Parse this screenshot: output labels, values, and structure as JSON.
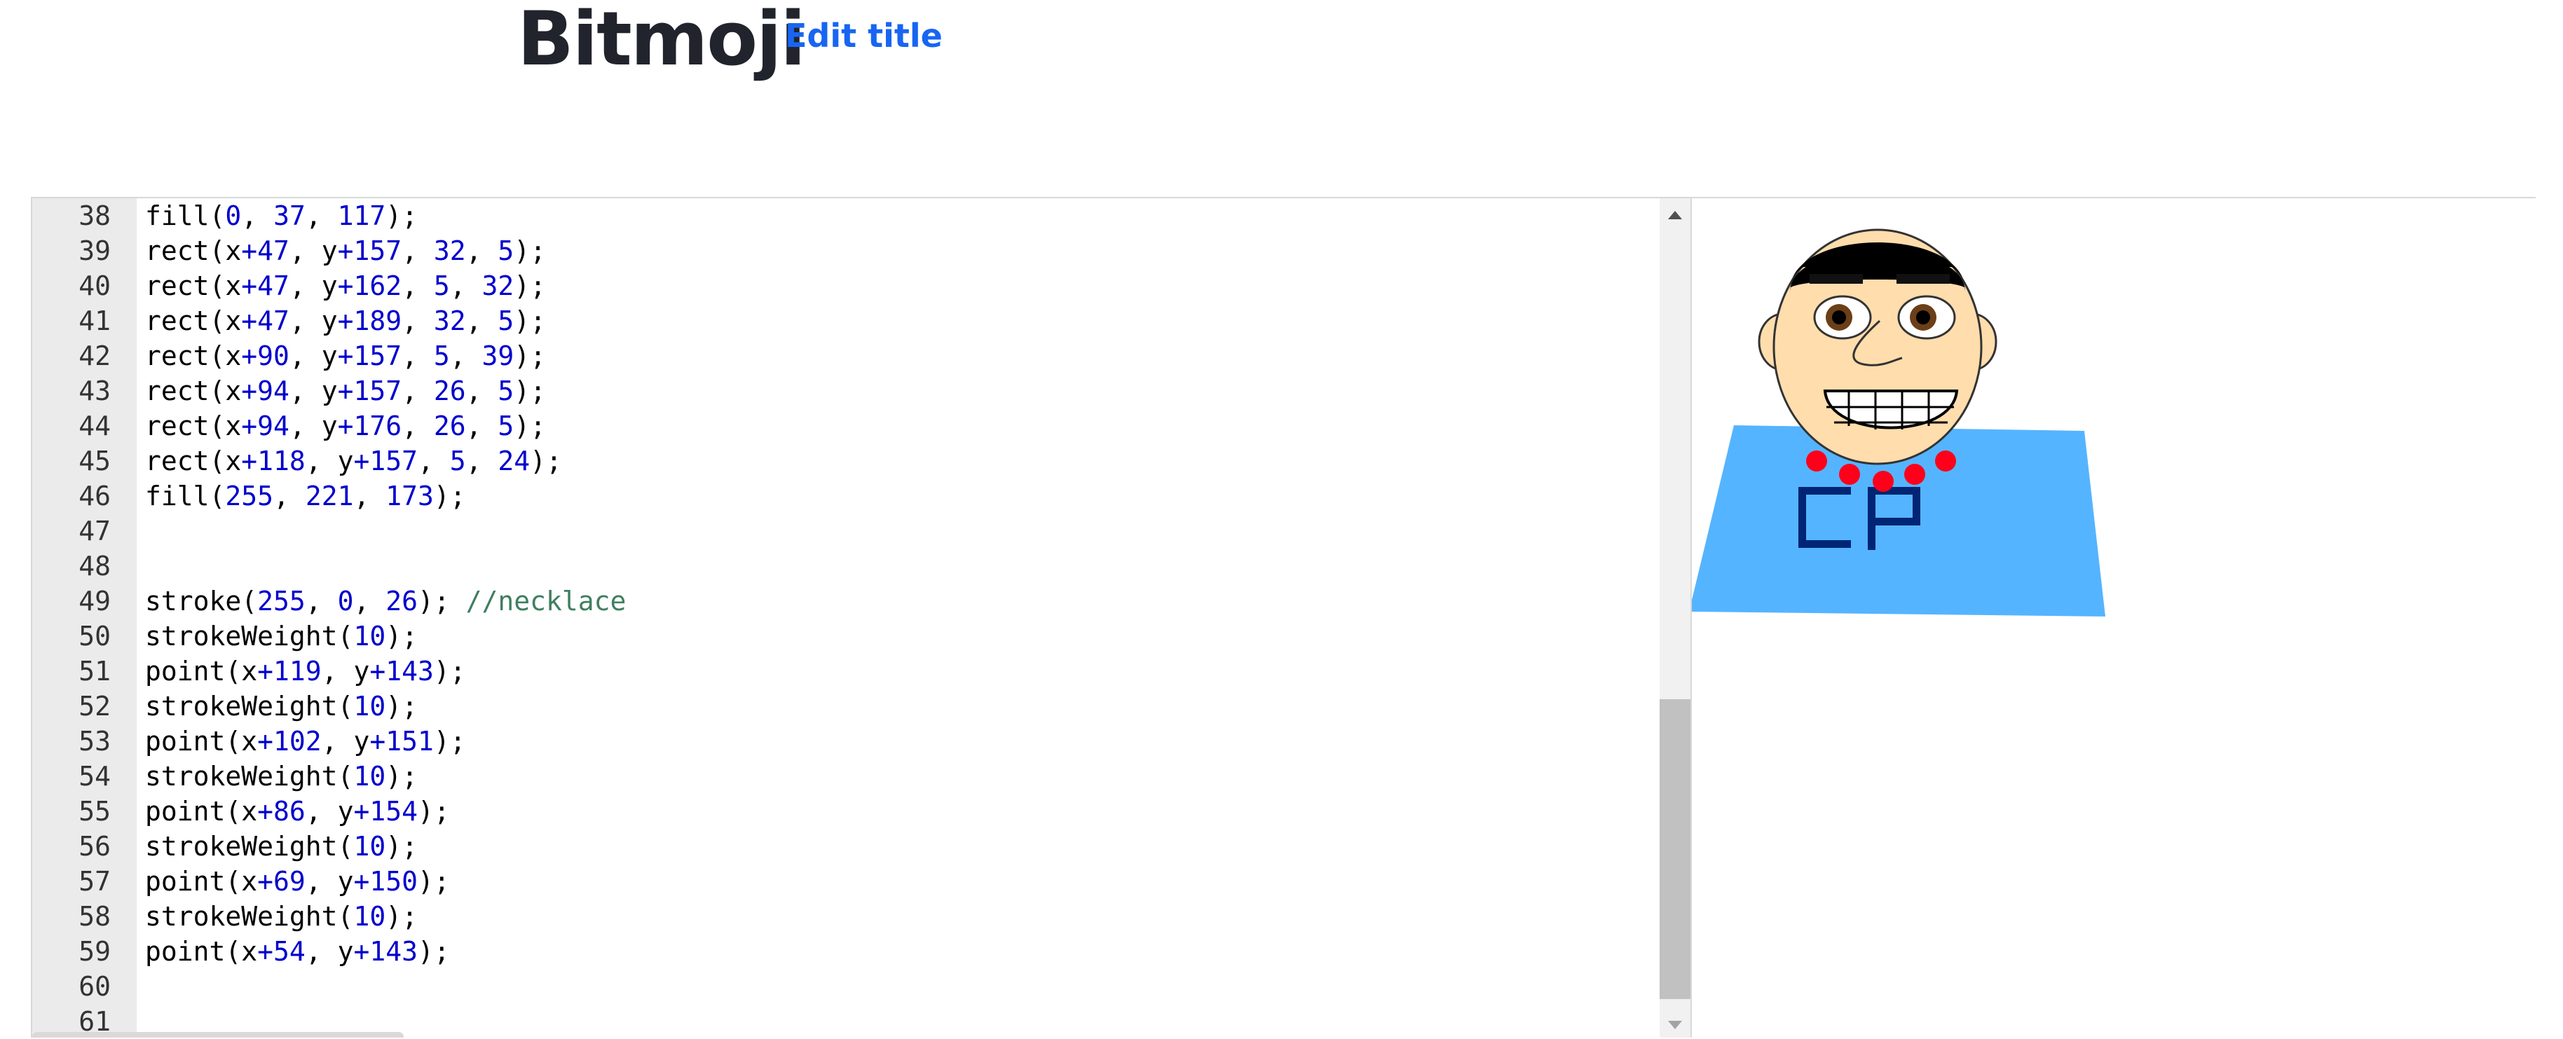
{
  "header": {
    "title": "Bitmoji",
    "edit_title_label": "Edit title"
  },
  "editor": {
    "lines": [
      {
        "n": "38",
        "tokens": [
          [
            "fn",
            "fill"
          ],
          [
            "p",
            "("
          ],
          [
            "num",
            "0"
          ],
          [
            "p",
            ", "
          ],
          [
            "num",
            "37"
          ],
          [
            "p",
            ", "
          ],
          [
            "num",
            "117"
          ],
          [
            "p",
            ");"
          ]
        ]
      },
      {
        "n": "39",
        "tokens": [
          [
            "fn",
            "rect"
          ],
          [
            "p",
            "(x"
          ],
          [
            "op",
            "+"
          ],
          [
            "num",
            "47"
          ],
          [
            "p",
            ", y"
          ],
          [
            "op",
            "+"
          ],
          [
            "num",
            "157"
          ],
          [
            "p",
            ", "
          ],
          [
            "num",
            "32"
          ],
          [
            "p",
            ", "
          ],
          [
            "num",
            "5"
          ],
          [
            "p",
            ");"
          ]
        ]
      },
      {
        "n": "40",
        "tokens": [
          [
            "fn",
            "rect"
          ],
          [
            "p",
            "(x"
          ],
          [
            "op",
            "+"
          ],
          [
            "num",
            "47"
          ],
          [
            "p",
            ", y"
          ],
          [
            "op",
            "+"
          ],
          [
            "num",
            "162"
          ],
          [
            "p",
            ", "
          ],
          [
            "num",
            "5"
          ],
          [
            "p",
            ", "
          ],
          [
            "num",
            "32"
          ],
          [
            "p",
            ");"
          ]
        ]
      },
      {
        "n": "41",
        "tokens": [
          [
            "fn",
            "rect"
          ],
          [
            "p",
            "(x"
          ],
          [
            "op",
            "+"
          ],
          [
            "num",
            "47"
          ],
          [
            "p",
            ", y"
          ],
          [
            "op",
            "+"
          ],
          [
            "num",
            "189"
          ],
          [
            "p",
            ", "
          ],
          [
            "num",
            "32"
          ],
          [
            "p",
            ", "
          ],
          [
            "num",
            "5"
          ],
          [
            "p",
            ");"
          ]
        ]
      },
      {
        "n": "42",
        "tokens": [
          [
            "fn",
            "rect"
          ],
          [
            "p",
            "(x"
          ],
          [
            "op",
            "+"
          ],
          [
            "num",
            "90"
          ],
          [
            "p",
            ", y"
          ],
          [
            "op",
            "+"
          ],
          [
            "num",
            "157"
          ],
          [
            "p",
            ", "
          ],
          [
            "num",
            "5"
          ],
          [
            "p",
            ", "
          ],
          [
            "num",
            "39"
          ],
          [
            "p",
            ");"
          ]
        ]
      },
      {
        "n": "43",
        "tokens": [
          [
            "fn",
            "rect"
          ],
          [
            "p",
            "(x"
          ],
          [
            "op",
            "+"
          ],
          [
            "num",
            "94"
          ],
          [
            "p",
            ", y"
          ],
          [
            "op",
            "+"
          ],
          [
            "num",
            "157"
          ],
          [
            "p",
            ", "
          ],
          [
            "num",
            "26"
          ],
          [
            "p",
            ", "
          ],
          [
            "num",
            "5"
          ],
          [
            "p",
            ");"
          ]
        ]
      },
      {
        "n": "44",
        "tokens": [
          [
            "fn",
            "rect"
          ],
          [
            "p",
            "(x"
          ],
          [
            "op",
            "+"
          ],
          [
            "num",
            "94"
          ],
          [
            "p",
            ", y"
          ],
          [
            "op",
            "+"
          ],
          [
            "num",
            "176"
          ],
          [
            "p",
            ", "
          ],
          [
            "num",
            "26"
          ],
          [
            "p",
            ", "
          ],
          [
            "num",
            "5"
          ],
          [
            "p",
            ");"
          ]
        ]
      },
      {
        "n": "45",
        "tokens": [
          [
            "fn",
            "rect"
          ],
          [
            "p",
            "(x"
          ],
          [
            "op",
            "+"
          ],
          [
            "num",
            "118"
          ],
          [
            "p",
            ", y"
          ],
          [
            "op",
            "+"
          ],
          [
            "num",
            "157"
          ],
          [
            "p",
            ", "
          ],
          [
            "num",
            "5"
          ],
          [
            "p",
            ", "
          ],
          [
            "num",
            "24"
          ],
          [
            "p",
            ");"
          ]
        ]
      },
      {
        "n": "46",
        "tokens": [
          [
            "fn",
            "fill"
          ],
          [
            "p",
            "("
          ],
          [
            "num",
            "255"
          ],
          [
            "p",
            ", "
          ],
          [
            "num",
            "221"
          ],
          [
            "p",
            ", "
          ],
          [
            "num",
            "173"
          ],
          [
            "p",
            ");"
          ]
        ]
      },
      {
        "n": "47",
        "tokens": []
      },
      {
        "n": "48",
        "tokens": []
      },
      {
        "n": "49",
        "tokens": [
          [
            "fn",
            "stroke"
          ],
          [
            "p",
            "("
          ],
          [
            "num",
            "255"
          ],
          [
            "p",
            ", "
          ],
          [
            "num",
            "0"
          ],
          [
            "p",
            ", "
          ],
          [
            "num",
            "26"
          ],
          [
            "p",
            "); "
          ],
          [
            "com",
            "//necklace"
          ]
        ]
      },
      {
        "n": "50",
        "tokens": [
          [
            "fn",
            "strokeWeight"
          ],
          [
            "p",
            "("
          ],
          [
            "num",
            "10"
          ],
          [
            "p",
            ");"
          ]
        ]
      },
      {
        "n": "51",
        "tokens": [
          [
            "fn",
            "point"
          ],
          [
            "p",
            "(x"
          ],
          [
            "op",
            "+"
          ],
          [
            "num",
            "119"
          ],
          [
            "p",
            ", y"
          ],
          [
            "op",
            "+"
          ],
          [
            "num",
            "143"
          ],
          [
            "p",
            ");"
          ]
        ]
      },
      {
        "n": "52",
        "tokens": [
          [
            "fn",
            "strokeWeight"
          ],
          [
            "p",
            "("
          ],
          [
            "num",
            "10"
          ],
          [
            "p",
            ");"
          ]
        ]
      },
      {
        "n": "53",
        "tokens": [
          [
            "fn",
            "point"
          ],
          [
            "p",
            "(x"
          ],
          [
            "op",
            "+"
          ],
          [
            "num",
            "102"
          ],
          [
            "p",
            ", y"
          ],
          [
            "op",
            "+"
          ],
          [
            "num",
            "151"
          ],
          [
            "p",
            ");"
          ]
        ]
      },
      {
        "n": "54",
        "tokens": [
          [
            "fn",
            "strokeWeight"
          ],
          [
            "p",
            "("
          ],
          [
            "num",
            "10"
          ],
          [
            "p",
            ");"
          ]
        ]
      },
      {
        "n": "55",
        "tokens": [
          [
            "fn",
            "point"
          ],
          [
            "p",
            "(x"
          ],
          [
            "op",
            "+"
          ],
          [
            "num",
            "86"
          ],
          [
            "p",
            ", y"
          ],
          [
            "op",
            "+"
          ],
          [
            "num",
            "154"
          ],
          [
            "p",
            ");"
          ]
        ]
      },
      {
        "n": "56",
        "tokens": [
          [
            "fn",
            "strokeWeight"
          ],
          [
            "p",
            "("
          ],
          [
            "num",
            "10"
          ],
          [
            "p",
            ");"
          ]
        ]
      },
      {
        "n": "57",
        "tokens": [
          [
            "fn",
            "point"
          ],
          [
            "p",
            "(x"
          ],
          [
            "op",
            "+"
          ],
          [
            "num",
            "69"
          ],
          [
            "p",
            ", y"
          ],
          [
            "op",
            "+"
          ],
          [
            "num",
            "150"
          ],
          [
            "p",
            ");"
          ]
        ]
      },
      {
        "n": "58",
        "tokens": [
          [
            "fn",
            "strokeWeight"
          ],
          [
            "p",
            "("
          ],
          [
            "num",
            "10"
          ],
          [
            "p",
            ");"
          ]
        ]
      },
      {
        "n": "59",
        "tokens": [
          [
            "fn",
            "point"
          ],
          [
            "p",
            "(x"
          ],
          [
            "op",
            "+"
          ],
          [
            "num",
            "54"
          ],
          [
            "p",
            ", y"
          ],
          [
            "op",
            "+"
          ],
          [
            "num",
            "143"
          ],
          [
            "p",
            ");"
          ]
        ]
      },
      {
        "n": "60",
        "tokens": []
      },
      {
        "n": "61",
        "tokens": []
      }
    ]
  },
  "canvas": {
    "shirt_text": "CP",
    "colors": {
      "shirt": "#55b4ff",
      "letters": "#002575",
      "skin": "#ffddad",
      "hair": "#000000",
      "necklace": "#ff001a"
    }
  },
  "icons": {
    "scroll_up": "scroll-up-arrow-icon",
    "scroll_down": "scroll-down-arrow-icon"
  }
}
